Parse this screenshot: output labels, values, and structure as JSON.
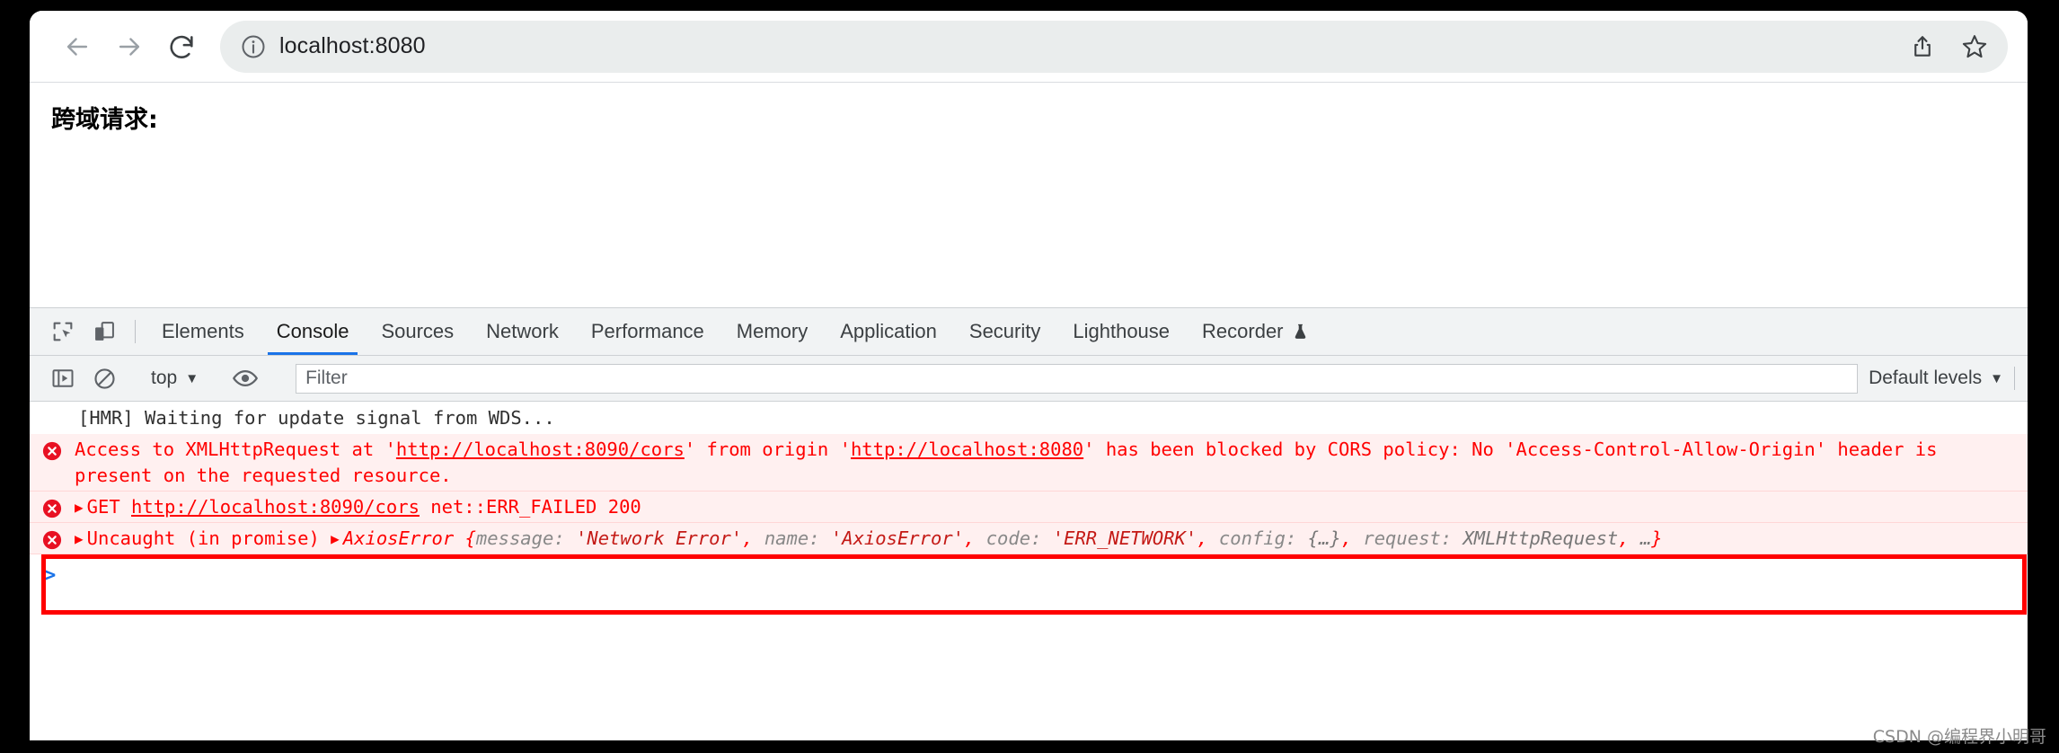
{
  "browser": {
    "nav": {
      "back_label": "Back",
      "forward_label": "Forward",
      "reload_label": "Reload"
    },
    "omnibox": {
      "site_info_label": "View site information",
      "url": "localhost:8080",
      "share_label": "Share this page",
      "bookmark_label": "Bookmark this tab"
    }
  },
  "page": {
    "heading": "跨域请求:"
  },
  "devtools": {
    "inspect_label": "Inspect element",
    "device_toolbar_label": "Toggle device toolbar",
    "tabs": [
      {
        "label": "Elements",
        "active": false
      },
      {
        "label": "Console",
        "active": true
      },
      {
        "label": "Sources",
        "active": false
      },
      {
        "label": "Network",
        "active": false
      },
      {
        "label": "Performance",
        "active": false
      },
      {
        "label": "Memory",
        "active": false
      },
      {
        "label": "Application",
        "active": false
      },
      {
        "label": "Security",
        "active": false
      },
      {
        "label": "Lighthouse",
        "active": false
      },
      {
        "label": "Recorder",
        "active": false,
        "badge": "experimental-flask-icon"
      }
    ],
    "filterbar": {
      "sidebar_toggle_label": "Show console sidebar",
      "clear_console_label": "Clear console",
      "context": "top",
      "context_caret": "▼",
      "eye_label": "Create live expression",
      "filter_placeholder": "Filter",
      "filter_value": "",
      "levels": "Default levels",
      "levels_caret": "▼"
    },
    "console": {
      "messages": [
        {
          "type": "info",
          "text": "[HMR] Waiting for update signal from WDS..."
        },
        {
          "type": "error",
          "icon": "error-circle-x-icon",
          "segments": [
            {
              "t": "Access to XMLHttpRequest at '",
              "style": "plain"
            },
            {
              "t": "http://localhost:8090/cors",
              "style": "link"
            },
            {
              "t": "' from origin '",
              "style": "plain"
            },
            {
              "t": "http://localhost:8080",
              "style": "link"
            },
            {
              "t": "' has been blocked by CORS policy: No 'Access-Control-Allow-Origin' header is present on the requested resource.",
              "style": "plain"
            }
          ]
        },
        {
          "type": "error",
          "icon": "error-circle-x-icon",
          "triangle": "▶",
          "segments": [
            {
              "t": "GET ",
              "style": "plain"
            },
            {
              "t": "http://localhost:8090/cors",
              "style": "link"
            },
            {
              "t": " net::ERR_FAILED 200",
              "style": "plain"
            }
          ]
        },
        {
          "type": "error",
          "icon": "error-circle-x-icon",
          "triangle": "▶",
          "prefix": "Uncaught (in promise) ",
          "object_triangle": "▶",
          "object_name": "AxiosError",
          "props": [
            {
              "key": "message: ",
              "value": "'Network Error'",
              "sep": ", "
            },
            {
              "key": "name: ",
              "value": "'AxiosError'",
              "sep": ", "
            },
            {
              "key": "code: ",
              "value": "'ERR_NETWORK'",
              "sep": ", "
            },
            {
              "key": "config: ",
              "value": "{…}",
              "sep": ", ",
              "value_plain": true
            },
            {
              "key": "request: ",
              "value": "XMLHttpRequest",
              "sep": ", ",
              "value_plain": true
            },
            {
              "key": "…",
              "value": "",
              "sep": ""
            }
          ],
          "open_brace": "{",
          "close_brace": "}"
        }
      ],
      "prompt": ">"
    }
  },
  "annotation": {
    "color": "#ff0000",
    "target": "cors-policy-error-message"
  },
  "watermark": "CSDN @编程界小明哥"
}
